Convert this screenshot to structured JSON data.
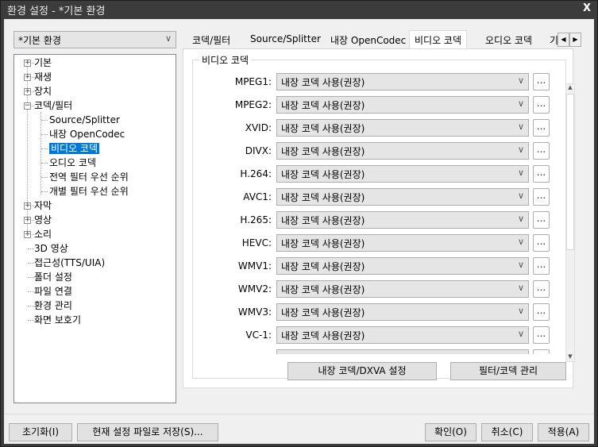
{
  "window": {
    "title": "환경 설정 - *기본 환경",
    "close": "X"
  },
  "profile": {
    "value": "*기본 환경"
  },
  "tree": [
    {
      "label": "기본",
      "expander": "+"
    },
    {
      "label": "재생",
      "expander": "+"
    },
    {
      "label": "장치",
      "expander": "+"
    },
    {
      "label": "코덱/필터",
      "expander": "−"
    },
    {
      "label": "Source/Splitter",
      "child": true
    },
    {
      "label": "내장 OpenCodec",
      "child": true
    },
    {
      "label": "비디오 코덱",
      "child": true,
      "selected": true
    },
    {
      "label": "오디오 코덱",
      "child": true
    },
    {
      "label": "전역 필터 우선 순위",
      "child": true
    },
    {
      "label": "개별 필터 우선 순위",
      "child": true
    },
    {
      "label": "자막",
      "expander": "+"
    },
    {
      "label": "영상",
      "expander": "+"
    },
    {
      "label": "소리",
      "expander": "+"
    },
    {
      "label": "3D 영상"
    },
    {
      "label": "접근성(TTS/UIA)"
    },
    {
      "label": "폴더 설정"
    },
    {
      "label": "파일 연결"
    },
    {
      "label": "환경 관리"
    },
    {
      "label": "화면 보호기"
    }
  ],
  "tabs": [
    "코덱/필터",
    "Source/Splitter",
    "내장 OpenCodec",
    "비디오 코덱",
    "오디오 코덱",
    "기"
  ],
  "active_tab": 3,
  "group": {
    "title": "비디오 코덱",
    "rows": [
      {
        "label": "MPEG1:",
        "value": "내장 코덱 사용(권장)"
      },
      {
        "label": "MPEG2:",
        "value": "내장 코덱 사용(권장)"
      },
      {
        "label": "XVID:",
        "value": "내장 코덱 사용(권장)"
      },
      {
        "label": "DIVX:",
        "value": "내장 코덱 사용(권장)"
      },
      {
        "label": "H.264:",
        "value": "내장 코덱 사용(권장)"
      },
      {
        "label": "AVC1:",
        "value": "내장 코덱 사용(권장)"
      },
      {
        "label": "H.265:",
        "value": "내장 코덱 사용(권장)"
      },
      {
        "label": "HEVC:",
        "value": "내장 코덱 사용(권장)"
      },
      {
        "label": "WMV1:",
        "value": "내장 코덱 사용(권장)"
      },
      {
        "label": "WMV2:",
        "value": "내장 코덱 사용(권장)"
      },
      {
        "label": "WMV3:",
        "value": "내장 코덱 사용(권장)"
      },
      {
        "label": "VC-1:",
        "value": "내장 코덱 사용(권장)"
      }
    ],
    "more": "..."
  },
  "panel_buttons": {
    "dxva": "내장 코덱/DXVA 설정",
    "filter": "필터/코덱 관리"
  },
  "footer": {
    "reset": "초기화(I)",
    "save": "현재 설정 파일로 저장(S)...",
    "ok": "확인(O)",
    "cancel": "취소(C)",
    "apply": "적용(A)"
  }
}
